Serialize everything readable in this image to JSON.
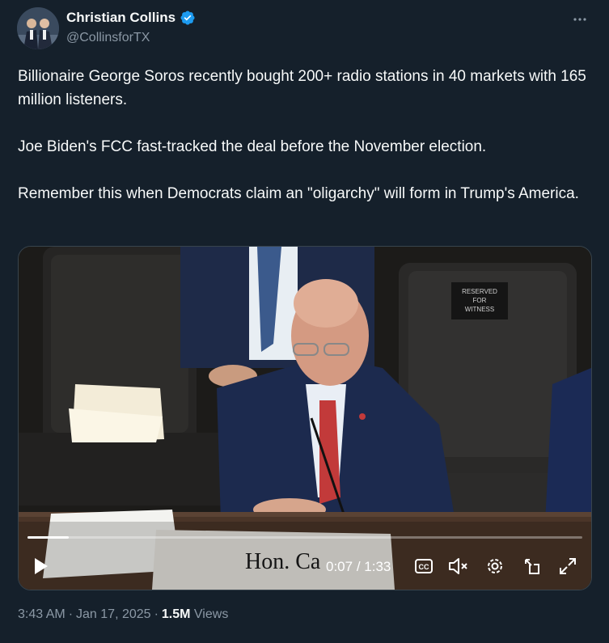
{
  "author": {
    "display_name": "Christian Collins",
    "handle": "@CollinsforTX",
    "verified": true
  },
  "post": {
    "paragraphs": [
      "Billionaire George Soros recently bought 200+ radio stations in 40 markets with 165 million listeners.",
      "Joe Biden's FCC fast-tracked the deal before the November election.",
      "Remember this when Democrats claim an \"oligarchy\" will form in Trump's America."
    ]
  },
  "video": {
    "current_time": "0:07",
    "separator": "/",
    "duration": "1:33",
    "progress": 0.075,
    "nameplate_text": "Hon. Ca",
    "chair_sign_text": "RESERVED FOR WITNESS",
    "icons": [
      "play-icon",
      "captions-icon",
      "volume-muted-icon",
      "settings-icon",
      "pop-out-icon",
      "fullscreen-icon"
    ]
  },
  "meta": {
    "time": "3:43 AM",
    "date": "Jan 17, 2025",
    "views_count": "1.5M",
    "views_label": "Views"
  },
  "colors": {
    "background": "#15202b",
    "text_primary": "#f7f9f9",
    "text_secondary": "#8b98a5",
    "verified_badge": "#1d9bf0"
  }
}
